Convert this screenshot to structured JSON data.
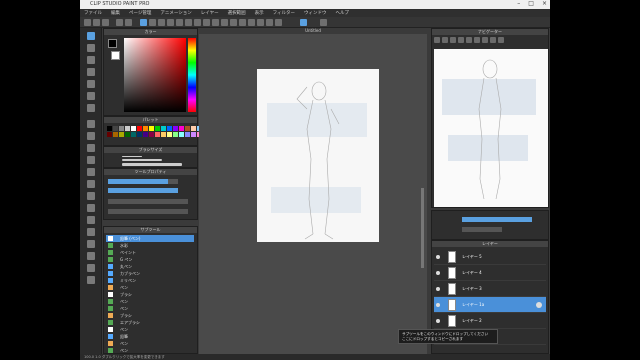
{
  "window": {
    "title": "CLIP STUDIO PAINT PRO"
  },
  "menu": [
    "ファイル",
    "編集",
    "ページ管理",
    "アニメーション",
    "レイヤー",
    "選択範囲",
    "表示",
    "フィルター",
    "ウィンドウ",
    "ヘルプ"
  ],
  "panels": {
    "color": "カラー",
    "palette": "パレット",
    "brush_size": "ブラシサイズ",
    "tool_property": "ツールプロパティ",
    "sub_tool": "サブツール",
    "navigator": "ナビゲーター",
    "layer": "レイヤー"
  },
  "canvas": {
    "title": "Untitled"
  },
  "sub_tools": [
    "鉛筆 (ペン)",
    "水彩",
    "ペイント",
    "G ペン",
    "丸ペン",
    "カブラペン",
    "ミリペン",
    "ペン",
    "ブラシ",
    "ペン",
    "ペン",
    "ブラシ",
    "エアブラシ",
    "ペン",
    "鉛筆",
    "ペン",
    "ペン"
  ],
  "layers": [
    {
      "name": "レイヤー 5",
      "selected": false
    },
    {
      "name": "レイヤー 4",
      "selected": false
    },
    {
      "name": "レイヤー 3",
      "selected": false
    },
    {
      "name": "レイヤー 1a",
      "selected": true
    },
    {
      "name": "レイヤー 2",
      "selected": false
    },
    {
      "name": "用紙",
      "selected": false
    }
  ],
  "toast": {
    "line1": "サブツールをこのウィンドウにドロップしてください",
    "line2": "ここにドロップするとコピーされます"
  },
  "status": "100.0   1.0   ダブルクリックで拡大率を変更できます"
}
